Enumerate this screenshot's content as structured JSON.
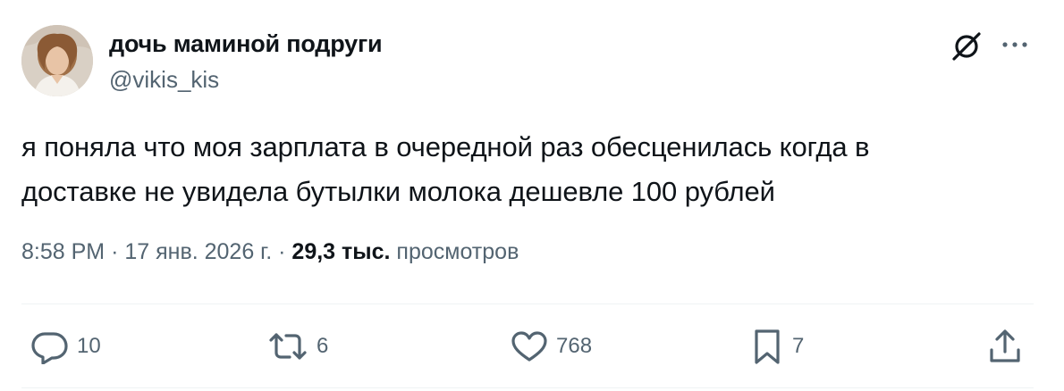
{
  "author": {
    "display_name": "дочь маминой подруги",
    "handle": "@vikis_kis"
  },
  "tweet": {
    "text_lines": [
      "я поняла что моя зарплата в очередной раз обесценилась когда в",
      "доставке не увидела бутылки молока дешевле 100 рублей"
    ],
    "time": "8:58 PM",
    "date": "17 янв. 2026 г.",
    "views_count": "29,3 тыс.",
    "views_label": "просмотров",
    "separator": "·"
  },
  "actions": {
    "replies": "10",
    "reposts": "6",
    "likes": "768",
    "bookmarks": "7"
  },
  "colors": {
    "text": "#0f1419",
    "secondary": "#536471",
    "divider": "#eff3f4"
  }
}
